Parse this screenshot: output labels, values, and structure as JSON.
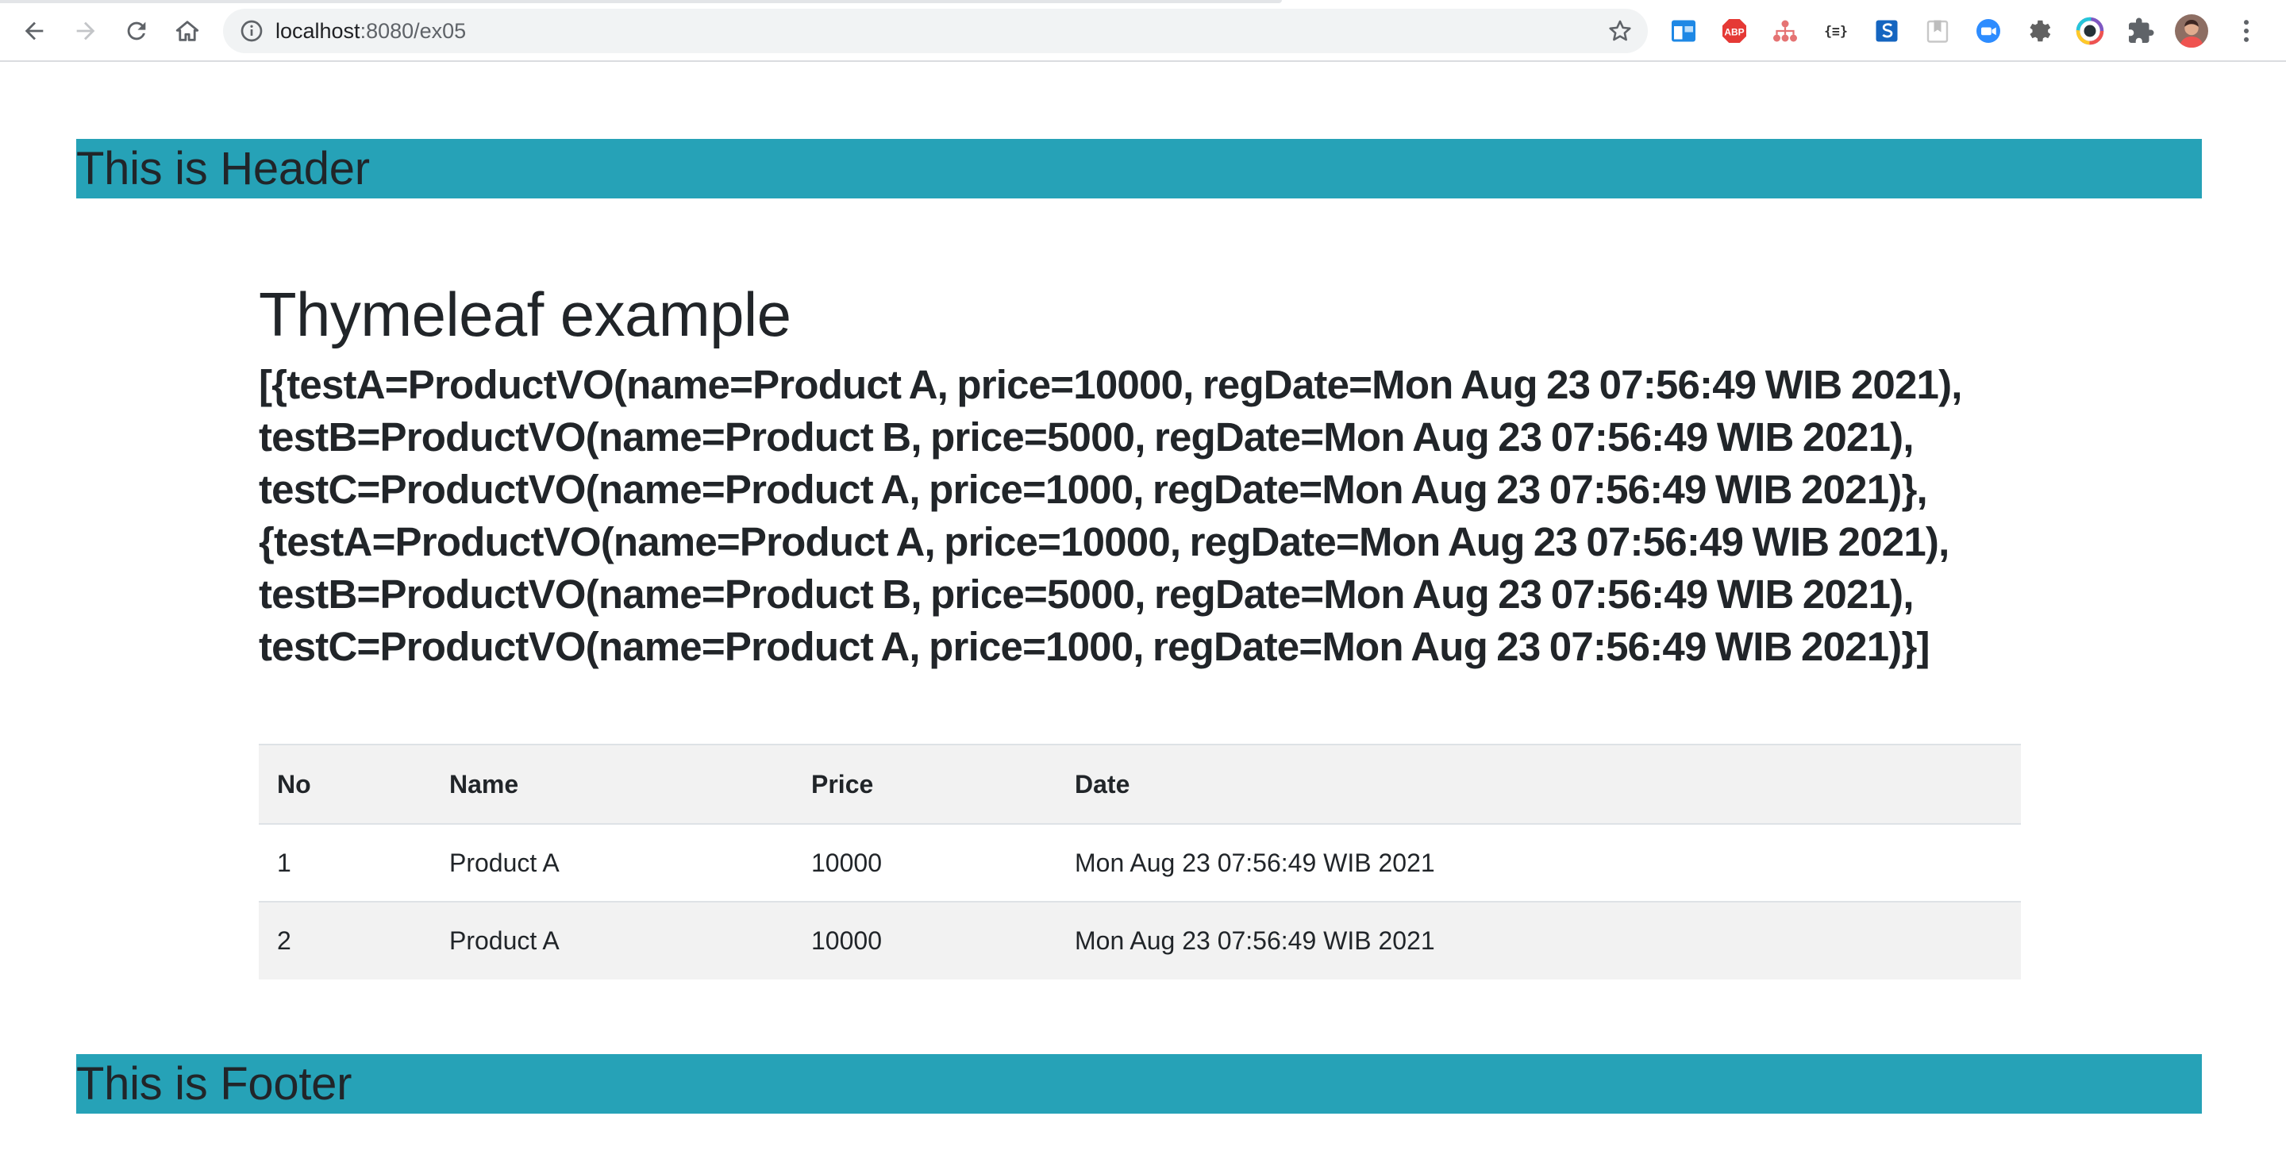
{
  "browser": {
    "url_host": "localhost",
    "url_path": ":8080/ex05"
  },
  "header": {
    "text": "This is Header"
  },
  "main": {
    "title": "Thymeleaf example",
    "dump": "[{testA=ProductVO(name=Product A, price=10000, regDate=Mon Aug 23 07:56:49 WIB 2021), testB=ProductVO(name=Product B, price=5000, regDate=Mon Aug 23 07:56:49 WIB 2021), testC=ProductVO(name=Product A, price=1000, regDate=Mon Aug 23 07:56:49 WIB 2021)}, {testA=ProductVO(name=Product A, price=10000, regDate=Mon Aug 23 07:56:49 WIB 2021), testB=ProductVO(name=Product B, price=5000, regDate=Mon Aug 23 07:56:49 WIB 2021), testC=ProductVO(name=Product A, price=1000, regDate=Mon Aug 23 07:56:49 WIB 2021)}]"
  },
  "table": {
    "columns": [
      "No",
      "Name",
      "Price",
      "Date"
    ],
    "rows": [
      [
        "1",
        "Product A",
        "10000",
        "Mon Aug 23 07:56:49 WIB 2021"
      ],
      [
        "2",
        "Product A",
        "10000",
        "Mon Aug 23 07:56:49 WIB 2021"
      ]
    ]
  },
  "footer": {
    "text": "This is Footer"
  },
  "colors": {
    "band": "#26a2b7",
    "text": "#212529",
    "table_stripe": "#f2f2f2"
  },
  "icons": {
    "toolbar": [
      "back-icon",
      "forward-icon",
      "reload-icon",
      "home-icon",
      "info-icon",
      "star-icon"
    ],
    "extensions": [
      "window-extension-icon",
      "adblock-plus-icon",
      "sitemap-extension-icon",
      "json-formatter-icon",
      "s-extension-icon",
      "bookmark-extension-icon",
      "zoom-extension-icon",
      "gear-extension-icon",
      "color-picker-extension-icon",
      "puzzle-extensions-icon",
      "profile-avatar",
      "more-menu-icon"
    ]
  }
}
